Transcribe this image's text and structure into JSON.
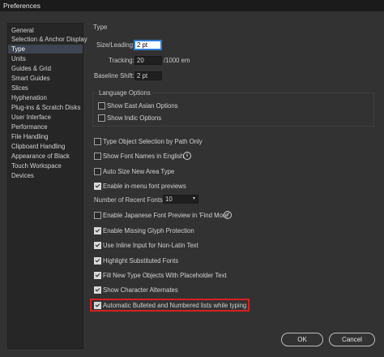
{
  "window": {
    "title": "Preferences"
  },
  "sidebar": {
    "items": [
      {
        "label": "General",
        "selected": false
      },
      {
        "label": "Selection & Anchor Display",
        "selected": false
      },
      {
        "label": "Type",
        "selected": true
      },
      {
        "label": "Units",
        "selected": false
      },
      {
        "label": "Guides & Grid",
        "selected": false
      },
      {
        "label": "Smart Guides",
        "selected": false
      },
      {
        "label": "Slices",
        "selected": false
      },
      {
        "label": "Hyphenation",
        "selected": false
      },
      {
        "label": "Plug-ins & Scratch Disks",
        "selected": false
      },
      {
        "label": "User Interface",
        "selected": false
      },
      {
        "label": "Performance",
        "selected": false
      },
      {
        "label": "File Handling",
        "selected": false
      },
      {
        "label": "Clipboard Handling",
        "selected": false
      },
      {
        "label": "Appearance of Black",
        "selected": false
      },
      {
        "label": "Touch Workspace",
        "selected": false
      },
      {
        "label": "Devices",
        "selected": false
      }
    ]
  },
  "main": {
    "heading": "Type",
    "size_leading": {
      "label": "Size/Leading:",
      "value": "2 pt"
    },
    "tracking": {
      "label": "Tracking:",
      "value": "20",
      "unit": "/1000 em"
    },
    "baseline_shift": {
      "label": "Baseline Shift:",
      "value": "2 pt"
    },
    "language_options": {
      "title": "Language Options",
      "options": [
        {
          "label": "Show East Asian Options",
          "checked": false
        },
        {
          "label": "Show Indic Options",
          "checked": false
        }
      ]
    },
    "checkboxes_a": [
      {
        "label": "Type Object Selection by Path Only",
        "checked": false
      },
      {
        "label": "Show Font Names in English",
        "checked": false
      },
      {
        "label": "Auto Size New Area Type",
        "checked": false
      },
      {
        "label": "Enable in-menu font previews",
        "checked": true
      }
    ],
    "recent_fonts": {
      "label": "Number of Recent Fonts:",
      "value": "10"
    },
    "checkboxes_b": [
      {
        "label": "Enable Japanese Font Preview in 'Find More'",
        "checked": false
      },
      {
        "label": "Enable Missing Glyph Protection",
        "checked": true
      },
      {
        "label": "Use Inline Input for Non-Latin Text",
        "checked": true
      },
      {
        "label": "Highlight Substituted Fonts",
        "checked": true
      },
      {
        "label": "Fill New Type Objects With Placeholder Text",
        "checked": true
      },
      {
        "label": "Show Character Alternates",
        "checked": true
      },
      {
        "label": "Automatic Bulleted and Numbered lists while typing",
        "checked": true
      }
    ],
    "info_glyph": "i",
    "chevron_glyph": "▾"
  },
  "buttons": {
    "ok": "OK",
    "cancel": "Cancel"
  },
  "colors": {
    "highlight_border": "#d62121",
    "selected_item_bg": "#3e4450",
    "focus_border": "#2f7bd4"
  }
}
